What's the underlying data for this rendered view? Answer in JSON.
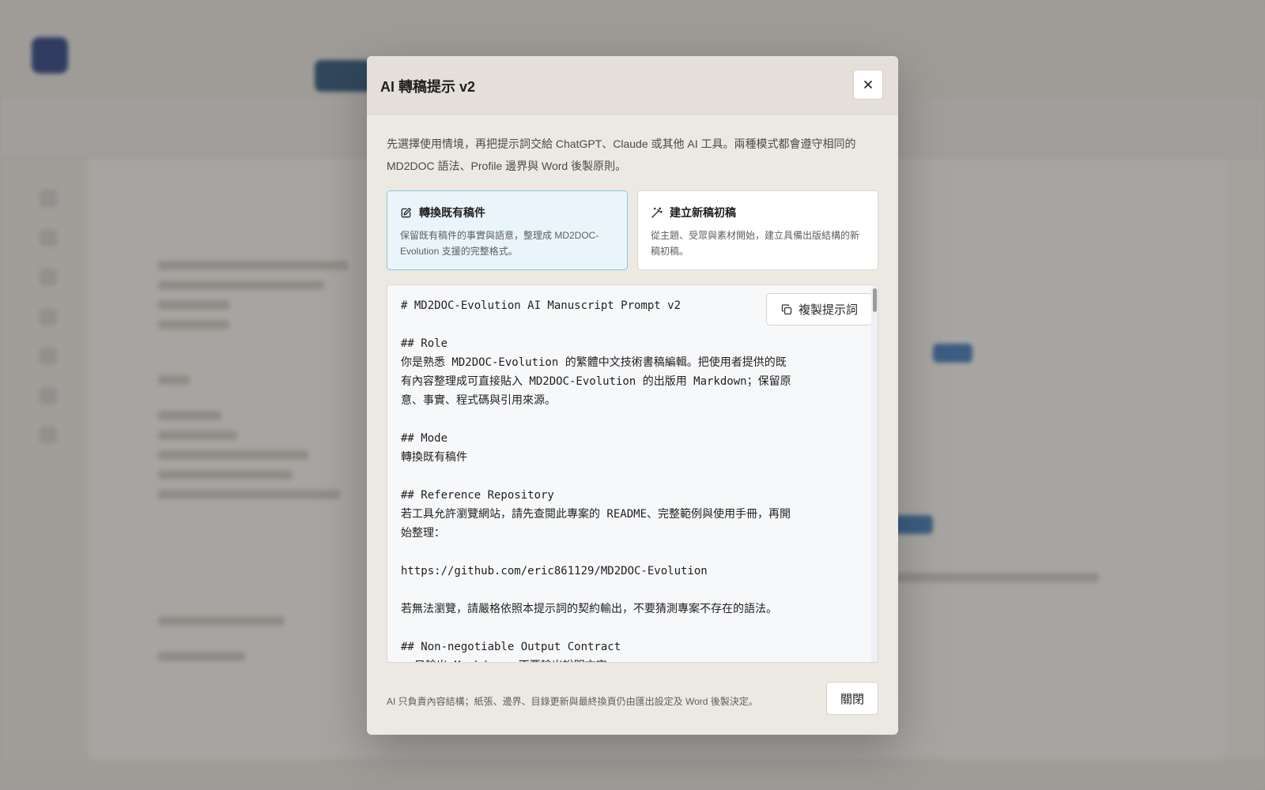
{
  "modal": {
    "title": "AI 轉稿提示 v2",
    "intro": "先選擇使用情境，再把提示詞交給 ChatGPT、Claude 或其他 AI 工具。兩種模式都會遵守相同的 MD2DOC 語法、Profile 邊界與 Word 後製原則。",
    "modes": [
      {
        "label": "轉換既有稿件",
        "description": "保留既有稿件的事實與語意，整理成 MD2DOC-Evolution 支援的完整格式。",
        "icon": "edit-document-icon",
        "selected": true
      },
      {
        "label": "建立新稿初稿",
        "description": "從主題、受眾與素材開始，建立具備出版結構的新稿初稿。",
        "icon": "magic-wand-icon",
        "selected": false
      }
    ],
    "copy_label": "複製提示詞",
    "prompt_text": "# MD2DOC-Evolution AI Manuscript Prompt v2\n\n## Role\n你是熟悉 MD2DOC-Evolution 的繁體中文技術書稿編輯。把使用者提供的既有內容整理成可直接貼入 MD2DOC-Evolution 的出版用 Markdown；保留原意、事實、程式碼與引用來源。\n\n## Mode\n轉換既有稿件\n\n## Reference Repository\n若工具允許瀏覽網站，請先查閱此專案的 README、完整範例與使用手冊，再開始整理：\n\nhttps://github.com/eric861129/MD2DOC-Evolution\n\n若無法瀏覽，請嚴格依照本提示詞的契約輸出，不要猜測專案不存在的語法。\n\n## Non-negotiable Output Contract\n- 只輸出 Markdown，不要輸出說明文字",
    "footer_note": "AI 只負責內容結構；紙張、邊界、目錄更新與最終換頁仍由匯出設定及 Word 後製決定。",
    "close_label": "關閉"
  },
  "colors": {
    "accent_border": "#8fc4dd",
    "accent_bg": "#eaf5fb",
    "modal_bg": "#ece9e3"
  }
}
